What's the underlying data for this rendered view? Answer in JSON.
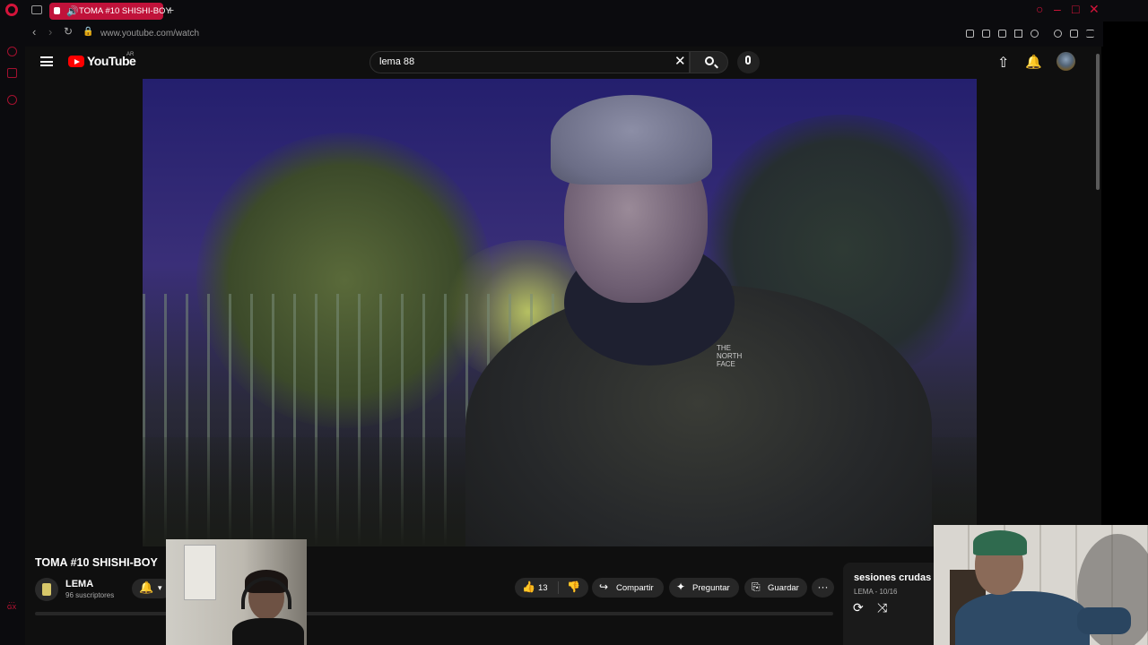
{
  "browser": {
    "tab_title": "TOMA #10 SHISHI-BOY",
    "url": "www.youtube.com/watch",
    "new_tab": "+",
    "sidebar_bottom_label": "GX",
    "sidebar_menu": "···",
    "window_controls": [
      "search-icon",
      "minimize-icon",
      "maximize-icon",
      "close-icon"
    ],
    "accent_color": "#d4143a"
  },
  "youtube": {
    "logo_text": "YouTube",
    "country_code": "AR",
    "search_query": "lema 88",
    "video": {
      "title": "TOMA #10 SHISHI-BOY",
      "channel": "LEMA",
      "subscribers": "96 suscriptores",
      "likes": "13",
      "share_label": "Compartir",
      "ask_label": "Preguntar",
      "save_label": "Guardar",
      "more_label": "···",
      "jacket_brand": "THE NORTH FACE"
    },
    "playlist": {
      "title": "sesiones crudas",
      "meta": "LEMA - 10/16"
    }
  }
}
